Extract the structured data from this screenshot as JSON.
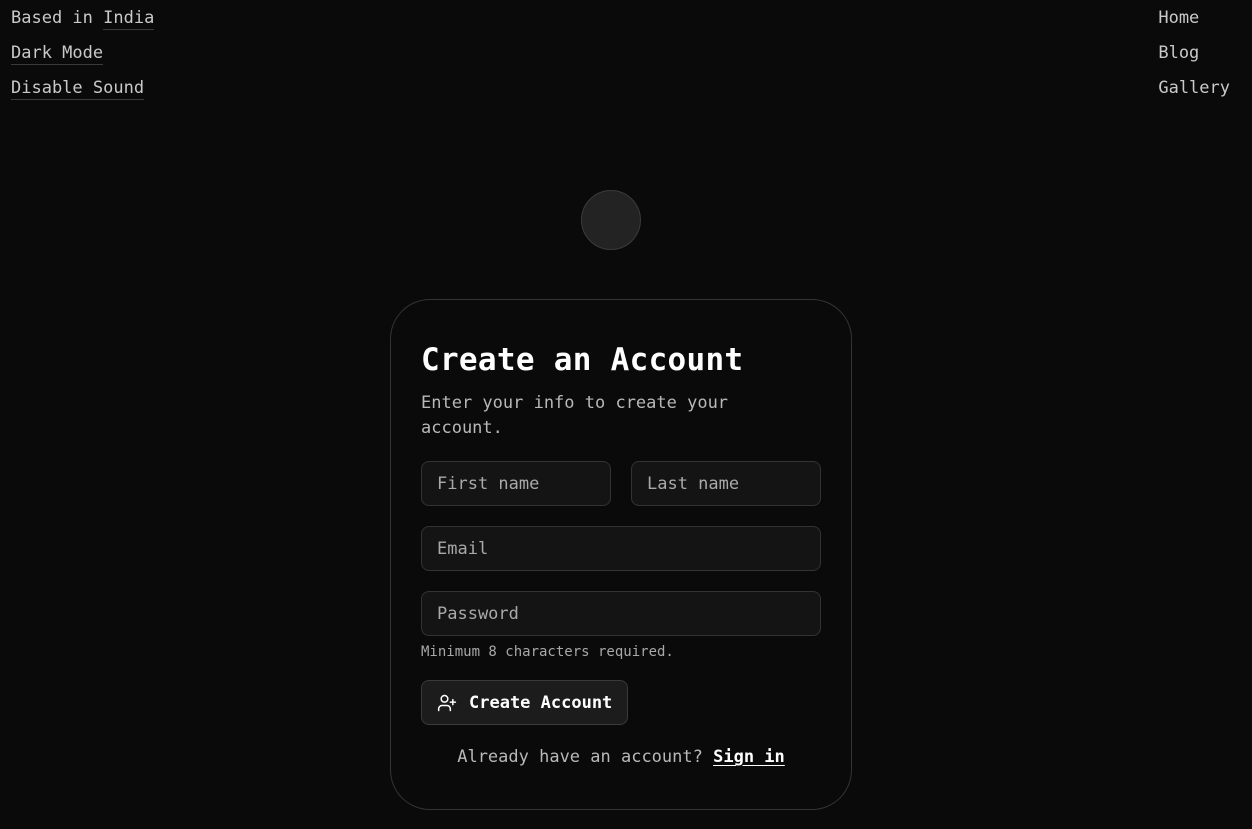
{
  "top_left": {
    "based_prefix": "Based in ",
    "location": "India",
    "dark_mode": "Dark Mode",
    "disable_sound": "Disable Sound"
  },
  "nav": {
    "home": "Home",
    "blog": "Blog",
    "gallery": "Gallery"
  },
  "form": {
    "title": "Create an Account",
    "subtitle": "Enter your info to create your account.",
    "first_name_placeholder": "First name",
    "last_name_placeholder": "Last name",
    "email_placeholder": "Email",
    "password_placeholder": "Password",
    "password_hint": "Minimum 8 characters required.",
    "submit_label": "Create Account",
    "submit_icon": "user-plus-icon",
    "signin_prompt": "Already have an account?",
    "signin_link": "Sign in"
  },
  "colors": {
    "background": "#0a0a0a",
    "card_border": "#343434",
    "input_background": "#141414"
  }
}
